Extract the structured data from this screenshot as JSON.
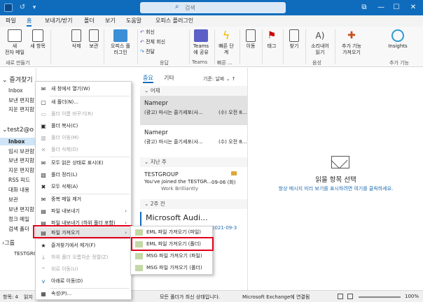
{
  "titlebar": {
    "search_placeholder": "검색",
    "minimize_glyph": "—",
    "maximize_glyph": "☐",
    "close_glyph": "✕",
    "ribbon_toggle_glyph": "⧉"
  },
  "menu": {
    "tabs": [
      "파일",
      "홈",
      "보내기/받기",
      "폴더",
      "보기",
      "도움말",
      "오피스 플러그인"
    ],
    "active": "홈"
  },
  "ribbon": {
    "new_mail": "새\n전자 메일",
    "new_items": "새 항목",
    "delete": "삭제",
    "archive": "보관",
    "office_plugin": "오피스 플\n러그인",
    "reply": "회신",
    "reply_all": "전체 회신",
    "forward": "전달",
    "teams": "Teams\n에 공유",
    "quick_steps": "빠른 단\n계",
    "move": "이동",
    "tags": "태그",
    "find": "찾기",
    "read_aloud": "소리내어\n읽기",
    "addins": "추가 기능\n가져오기",
    "insights": "Insights",
    "group_new": "새로 만들기",
    "group_reply": "응답",
    "group_teams": "Teams",
    "group_quickstep": "빠른 ...",
    "group_voice": "음성",
    "group_addins": "추가 기능"
  },
  "folderpane": {
    "favorites": "즐겨찾기",
    "fav_items": [
      "Inbox",
      "보낸 편지함",
      "지운 편지함"
    ],
    "account": "test2@o",
    "account_items": [
      "Inbox",
      "임시 보관함",
      "보낸 편지함",
      "지운 편지함",
      "RSS 피드",
      "대화 내용",
      "보관",
      "보낸 편지함",
      "정크 메일",
      "검색 폴더"
    ],
    "groups": "그룹",
    "group_item": "TESTGRO",
    "footer_count": "항목: 4",
    "footer_read": "읽지"
  },
  "msglist": {
    "tab_focused": "중요",
    "tab_other": "기타",
    "sort": "기준: 날짜",
    "section_yesterday": "어제",
    "section_last_week": "지난 주",
    "section_two_weeks": "2주 전",
    "items": [
      {
        "sender": "Namepr",
        "subject": "(광고) 마시는 즐기세포(사...",
        "date": "(수) 오전 8..."
      },
      {
        "sender": "Namepr",
        "subject": "(광고) 마시는 즐기세포(사...",
        "date": "(수) 오전 8..."
      },
      {
        "sender": "TESTGROUP",
        "subject": "You've joined the TESTGR...",
        "date": "09-06 (화)",
        "preview": "Work Brilliantly"
      },
      {
        "sender": "Microsoft Audi...",
        "subject": "",
        "date": "2021-09-3"
      }
    ]
  },
  "readingpane": {
    "title": "읽을 항목 선택",
    "subtitle": "항상 메시지 미리 보기를 표시하려면 여기를 클릭하세요."
  },
  "statusbar": {
    "status": "모든 폴더가 최신 상태입니다.",
    "connection": "Microsoft Exchange에 연결됨",
    "zoom": "100%"
  },
  "contextmenu": {
    "items": [
      {
        "label": "새 창에서 열기(W)",
        "icon": "✉",
        "disabled": false
      },
      {
        "label": "새 폴더(N)...",
        "icon": "▢",
        "disabled": false
      },
      {
        "label": "폴더 이름 바꾸기(R)",
        "icon": "▭",
        "disabled": true
      },
      {
        "label": "폴더 복사(C)",
        "icon": "▣",
        "disabled": false
      },
      {
        "label": "폴더 이동(M)",
        "icon": "▥",
        "disabled": true
      },
      {
        "label": "폴더 삭제(D)",
        "icon": "✕",
        "disabled": true
      },
      {
        "label": "모두 읽은 상태로 표시(E)",
        "icon": "✉",
        "disabled": false
      },
      {
        "label": "폴더 정리(L)",
        "icon": "▧",
        "disabled": false
      },
      {
        "label": "모두 삭제(A)",
        "icon": "✖",
        "disabled": false
      },
      {
        "label": "중복 메일 제거",
        "icon": "✉",
        "disabled": false
      },
      {
        "label": "파일 내보내기",
        "icon": "▤",
        "disabled": false,
        "submenu": true
      },
      {
        "label": "파일 내보내기 (하위 폴더 포함)",
        "icon": "▤",
        "disabled": false,
        "submenu": true
      },
      {
        "label": "파일 가져오기",
        "icon": "▤",
        "disabled": false,
        "submenu": true,
        "highlight": true
      },
      {
        "label": "즐겨찾기에서 제거(F)",
        "icon": "★",
        "disabled": false
      },
      {
        "label": "하위 폴더 오름차순 정렬(Z)",
        "icon": "↓",
        "disabled": true
      },
      {
        "label": "위로 이동(U)",
        "icon": "^",
        "disabled": true
      },
      {
        "label": "아래로 이동(D)",
        "icon": "v",
        "disabled": false
      },
      {
        "label": "속성(P)...",
        "icon": "▦",
        "disabled": false
      }
    ]
  },
  "submenu": {
    "items": [
      "EML 파일 가져오기 (파일)",
      "EML 파일 가져오기 (폴더)",
      "MSG 파일 가져오기 (파일)",
      "MSG 파일 가져오기 (폴더)"
    ]
  },
  "colors": {
    "accent": "#0f6cbd",
    "highlight_border": "#e2001a"
  }
}
